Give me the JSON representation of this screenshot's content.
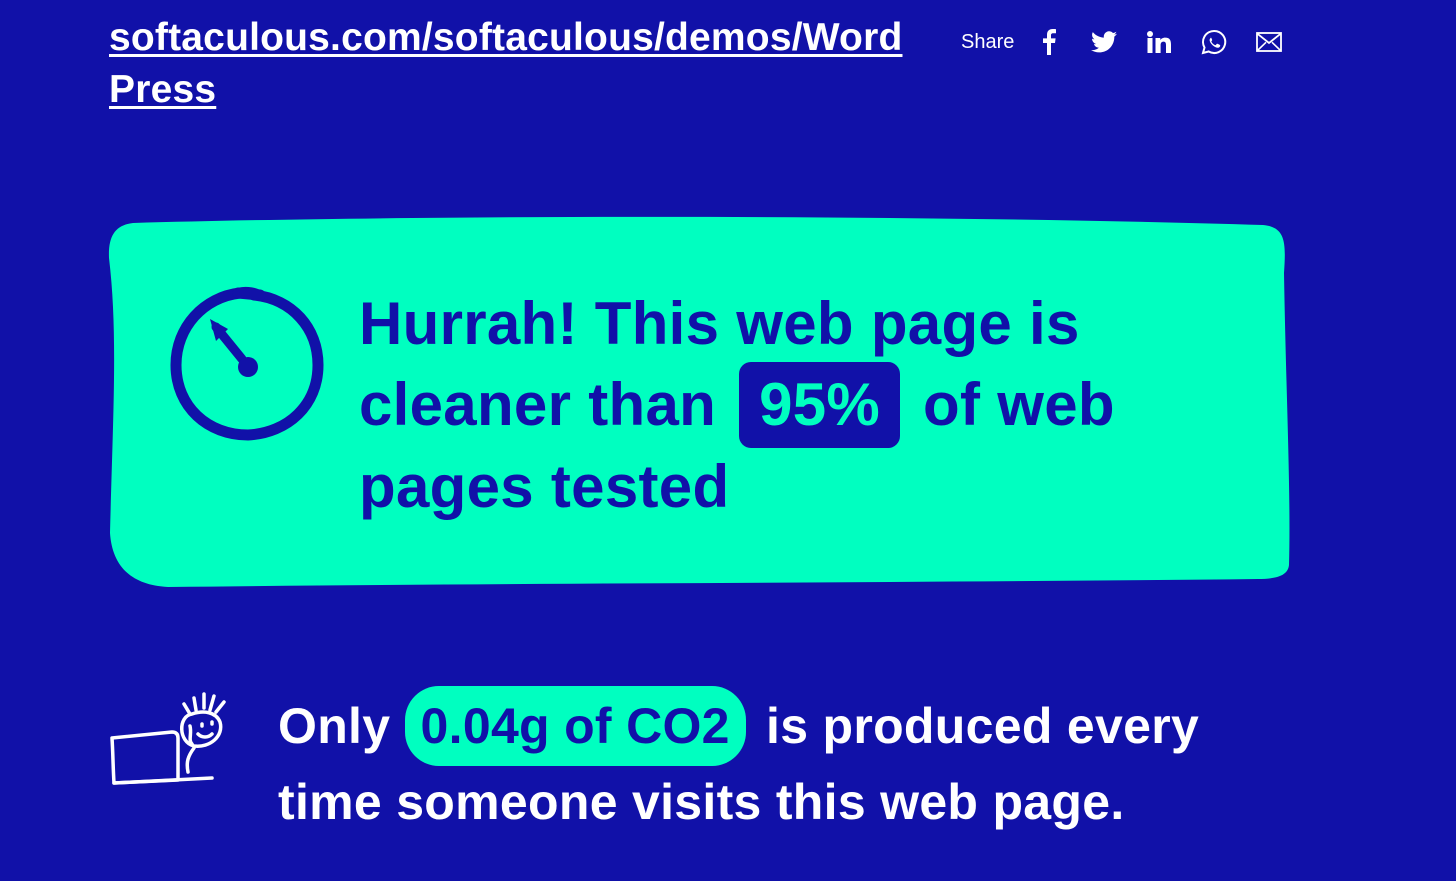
{
  "header": {
    "url_text": "softaculous.com/softaculous/demos/WordPress",
    "share_label": "Share",
    "share_icons": [
      "facebook-icon",
      "twitter-icon",
      "linkedin-icon",
      "whatsapp-icon",
      "email-icon"
    ]
  },
  "result": {
    "icon": "stopwatch-icon",
    "line_before": "Hurrah! This web page is cleaner than",
    "percentage": "95%",
    "line_after": "of web pages tested"
  },
  "co2": {
    "icon": "person-at-laptop-icon",
    "prefix": "Only",
    "amount": "0.04g of CO2",
    "suffix": "is produced every time someone visits this web page."
  },
  "colors": {
    "background": "#1111a8",
    "accent": "#00ffc0",
    "text_light": "#ffffff"
  }
}
